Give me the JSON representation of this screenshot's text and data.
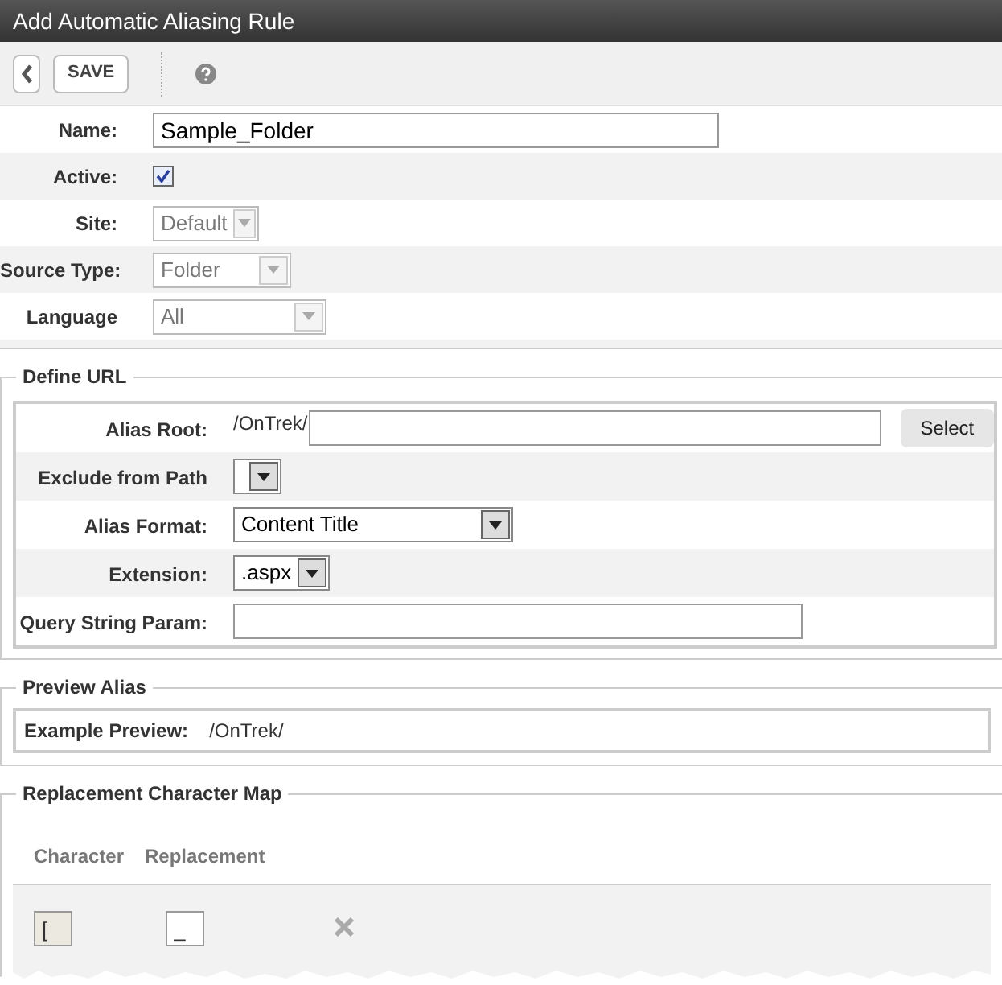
{
  "window": {
    "title": "Add Automatic Aliasing Rule"
  },
  "toolbar": {
    "save": "SAVE"
  },
  "form": [
    {
      "kind": "text",
      "label": "Name:",
      "value": "Sample_Folder"
    },
    {
      "kind": "checkbox",
      "label": "Active:",
      "checked": true
    },
    {
      "kind": "select",
      "label": "Site:",
      "value": "Default",
      "disabled": true
    },
    {
      "kind": "select",
      "label": "Source Type:",
      "value": "Folder",
      "disabled": true
    },
    {
      "kind": "select",
      "label": "Language",
      "value": "All",
      "disabled": true
    }
  ],
  "define_url": {
    "legend": "Define URL",
    "rows": [
      {
        "kind": "root",
        "label": "Alias Root:",
        "prefix": "/OnTrek/",
        "button": "Select"
      },
      {
        "kind": "select",
        "label": "Exclude from Path"
      },
      {
        "kind": "select",
        "label": "Alias Format:",
        "value": "Content Title"
      },
      {
        "kind": "select",
        "label": "Extension:",
        "value": ".aspx"
      },
      {
        "kind": "text",
        "label": "Query String Param:"
      }
    ]
  },
  "preview": {
    "legend": "Preview Alias",
    "label": "Example Preview:",
    "value": "/OnTrek/"
  },
  "replacement_map": {
    "legend": "Replacement Character Map",
    "columns": [
      "Character",
      "Replacement"
    ],
    "rows": [
      {
        "character": "[",
        "replacement": "_"
      }
    ]
  }
}
